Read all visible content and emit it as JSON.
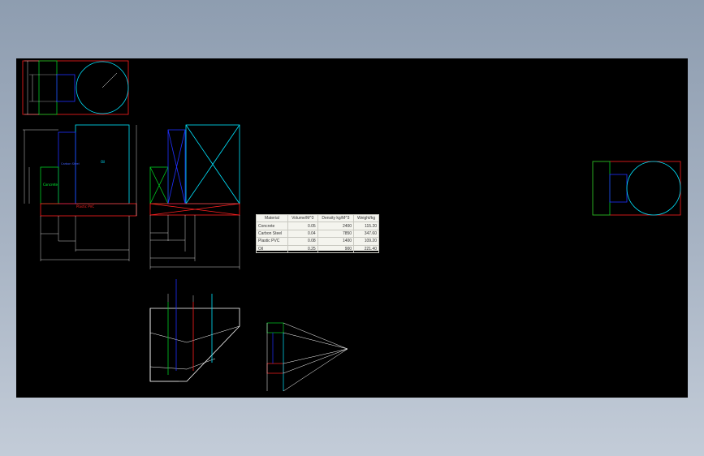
{
  "colors": {
    "background_outer": "#9aa8b8",
    "canvas": "#000000",
    "red": "#ff2020",
    "green": "#00cc22",
    "blue": "#2030ff",
    "cyan": "#00e5ff",
    "white": "#ffffff"
  },
  "labels": {
    "carbon_steel": "Carbon Steel",
    "oil": "Oil",
    "concrete": "Concrete",
    "plastic_pvc": "Plastic PVC"
  },
  "bom": {
    "headers": [
      "Material",
      "Volume/M^3",
      "Density kg/M^3",
      "Weight/kg"
    ],
    "rows": [
      [
        "Concrete",
        "0.05",
        "2400",
        "115.20"
      ],
      [
        "Carbon Steel",
        "0.04",
        "7850",
        "347.60"
      ],
      [
        "Plastic PVC",
        "0.08",
        "1400",
        "109.20"
      ],
      [
        "Oil",
        "0.25",
        "900",
        "221.40"
      ]
    ]
  }
}
